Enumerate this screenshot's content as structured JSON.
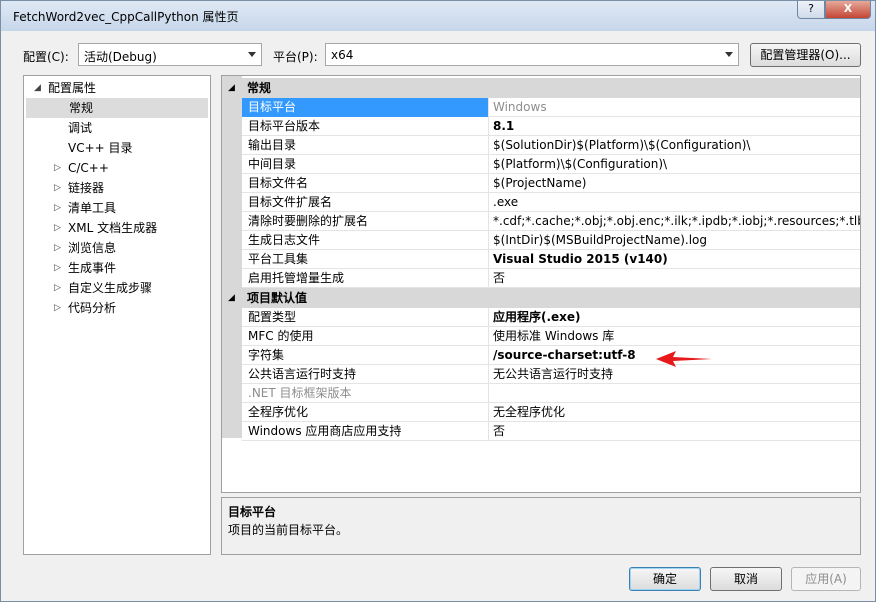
{
  "window": {
    "title": "FetchWord2vec_CppCallPython 属性页",
    "help": "?",
    "close": "X"
  },
  "toolbar": {
    "config_label": "配置(C):",
    "config_value": "活动(Debug)",
    "platform_label": "平台(P):",
    "platform_value": "x64",
    "manager_button": "配置管理器(O)..."
  },
  "tree": {
    "root": "配置属性",
    "items": [
      "常规",
      "调试",
      "VC++ 目录",
      "C/C++",
      "链接器",
      "清单工具",
      "XML 文档生成器",
      "浏览信息",
      "生成事件",
      "自定义生成步骤",
      "代码分析"
    ]
  },
  "grid": {
    "sections": [
      "常规",
      "项目默认值"
    ],
    "general": [
      {
        "name": "目标平台",
        "value": "Windows"
      },
      {
        "name": "目标平台版本",
        "value": "8.1"
      },
      {
        "name": "输出目录",
        "value": "$(SolutionDir)$(Platform)\\$(Configuration)\\"
      },
      {
        "name": "中间目录",
        "value": "$(Platform)\\$(Configuration)\\"
      },
      {
        "name": "目标文件名",
        "value": "$(ProjectName)"
      },
      {
        "name": "目标文件扩展名",
        "value": ".exe"
      },
      {
        "name": "清除时要删除的扩展名",
        "value": "*.cdf;*.cache;*.obj;*.obj.enc;*.ilk;*.ipdb;*.iobj;*.resources;*.tlb;*.tli;*"
      },
      {
        "name": "生成日志文件",
        "value": "$(IntDir)$(MSBuildProjectName).log"
      },
      {
        "name": "平台工具集",
        "value": "Visual Studio 2015 (v140)"
      },
      {
        "name": "启用托管增量生成",
        "value": "否"
      }
    ],
    "defaults": [
      {
        "name": "配置类型",
        "value": "应用程序(.exe)"
      },
      {
        "name": "MFC 的使用",
        "value": "使用标准 Windows 库"
      },
      {
        "name": "字符集",
        "value": "/source-charset:utf-8"
      },
      {
        "name": "公共语言运行时支持",
        "value": "无公共语言运行时支持"
      },
      {
        "name": ".NET 目标框架版本",
        "value": ""
      },
      {
        "name": "全程序优化",
        "value": "无全程序优化"
      },
      {
        "name": "Windows 应用商店应用支持",
        "value": "否"
      }
    ]
  },
  "description": {
    "title": "目标平台",
    "text": "项目的当前目标平台。"
  },
  "buttons": {
    "ok": "确定",
    "cancel": "取消",
    "apply": "应用(A)"
  },
  "colors": {
    "selection": "#3399ff",
    "annotation_arrow": "#e8191c"
  }
}
